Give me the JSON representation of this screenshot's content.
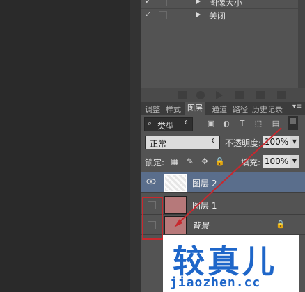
{
  "actions": {
    "items": [
      {
        "label": "图像大小",
        "checked": true
      },
      {
        "label": "关闭",
        "checked": true
      }
    ]
  },
  "tabs": [
    {
      "label": "调整",
      "active": false
    },
    {
      "label": "样式",
      "active": false
    },
    {
      "label": "图层",
      "active": true
    },
    {
      "label": "通道",
      "active": false
    },
    {
      "label": "路径",
      "active": false
    },
    {
      "label": "历史记录",
      "active": false
    }
  ],
  "filter": {
    "type_label": "类型"
  },
  "blend": {
    "mode": "正常",
    "opacity_label": "不透明度:",
    "opacity_value": "100%"
  },
  "lock": {
    "label": "锁定:",
    "fill_label": "填充:",
    "fill_value": "100%"
  },
  "layers": [
    {
      "name": "图层 2",
      "visible": true,
      "selected": true
    },
    {
      "name": "图层 1",
      "visible": false,
      "selected": false
    },
    {
      "name": "背景",
      "visible": false,
      "selected": false,
      "locked": true
    }
  ],
  "watermark": {
    "title": "较真儿",
    "url": "jiaozhen.cc"
  },
  "colors": {
    "annotation": "#c8282e",
    "selection": "#5a6e8c",
    "brand": "#1e66c9"
  }
}
